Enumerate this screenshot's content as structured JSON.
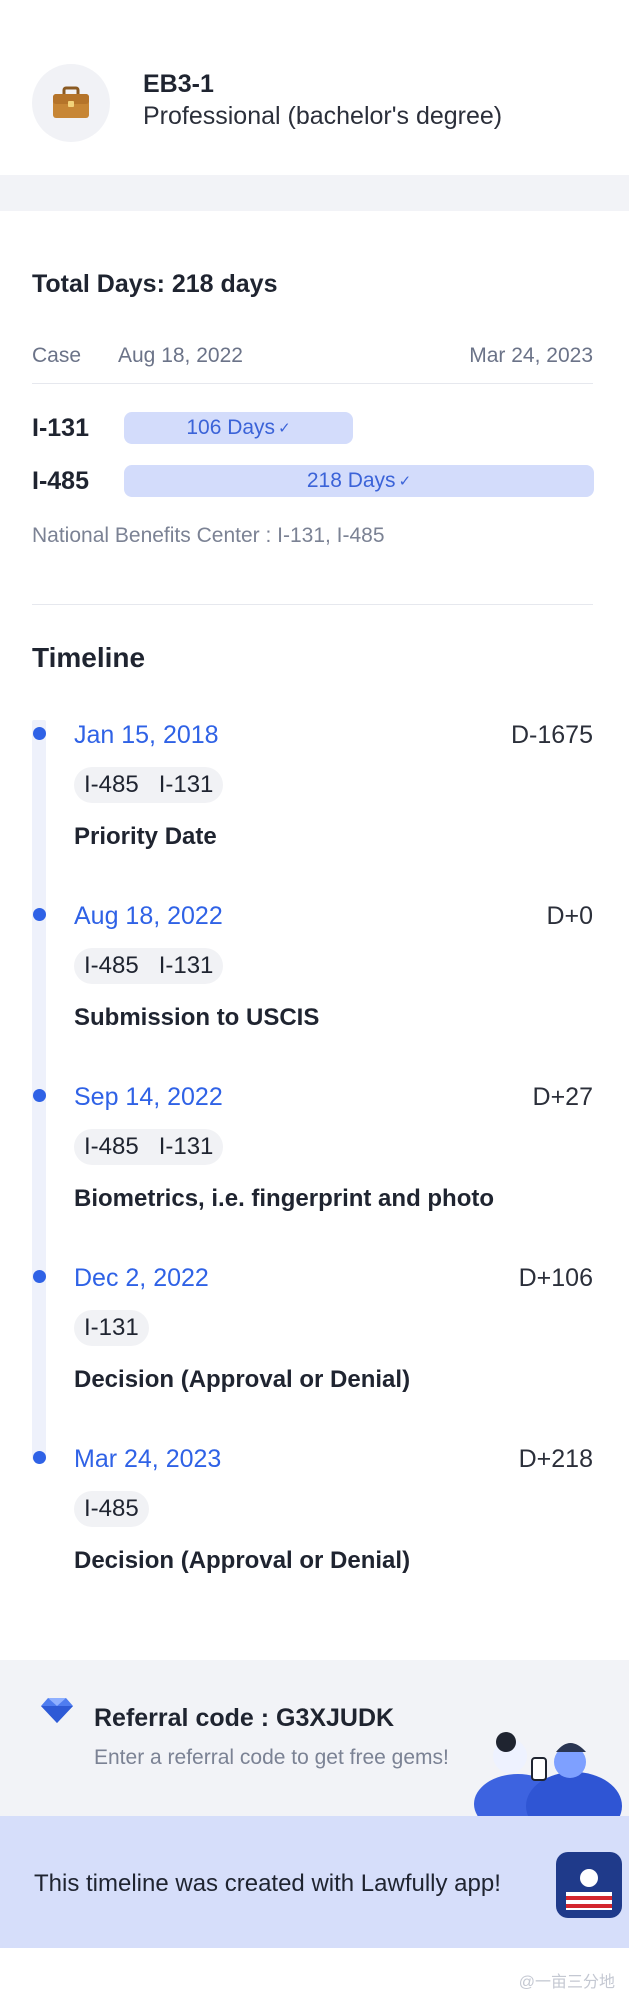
{
  "header": {
    "case_code": "EB3-1",
    "case_type": "Professional (bachelor's degree)",
    "icon": "briefcase-icon"
  },
  "summary": {
    "total_days": "Total Days: 218 days",
    "case_label": "Case",
    "start_date": "Aug 18, 2022",
    "end_date": "Mar 24, 2023",
    "bars": [
      {
        "form": "I-131",
        "label": "106 Days",
        "days": 106
      },
      {
        "form": "I-485",
        "label": "218 Days",
        "days": 218
      }
    ],
    "note": "National Benefits Center : I-131, I-485"
  },
  "timeline": {
    "title": "Timeline",
    "events": [
      {
        "date": "Jan 15, 2018",
        "day": "D-1675",
        "forms": [
          "I-485",
          "I-131"
        ],
        "title": "Priority Date"
      },
      {
        "date": "Aug 18, 2022",
        "day": "D+0",
        "forms": [
          "I-485",
          "I-131"
        ],
        "title": "Submission to USCIS"
      },
      {
        "date": "Sep 14, 2022",
        "day": "D+27",
        "forms": [
          "I-485",
          "I-131"
        ],
        "title": "Biometrics, i.e. fingerprint and photo"
      },
      {
        "date": "Dec 2, 2022",
        "day": "D+106",
        "forms": [
          "I-131"
        ],
        "title": "Decision (Approval or Denial)"
      },
      {
        "date": "Mar 24, 2023",
        "day": "D+218",
        "forms": [
          "I-485"
        ],
        "title": "Decision (Approval or Denial)"
      }
    ]
  },
  "referral": {
    "title": "Referral code : G3XJUDK",
    "subtitle": "Enter a referral code to get free gems!",
    "icon": "diamond-icon"
  },
  "banner": {
    "text": "This timeline was created with Lawfully app!"
  },
  "watermark": "@一亩三分地",
  "colors": {
    "accent": "#2f62e6",
    "bar": "#d3dcfb",
    "band": "#f2f3f7",
    "banner": "#d6defa"
  }
}
